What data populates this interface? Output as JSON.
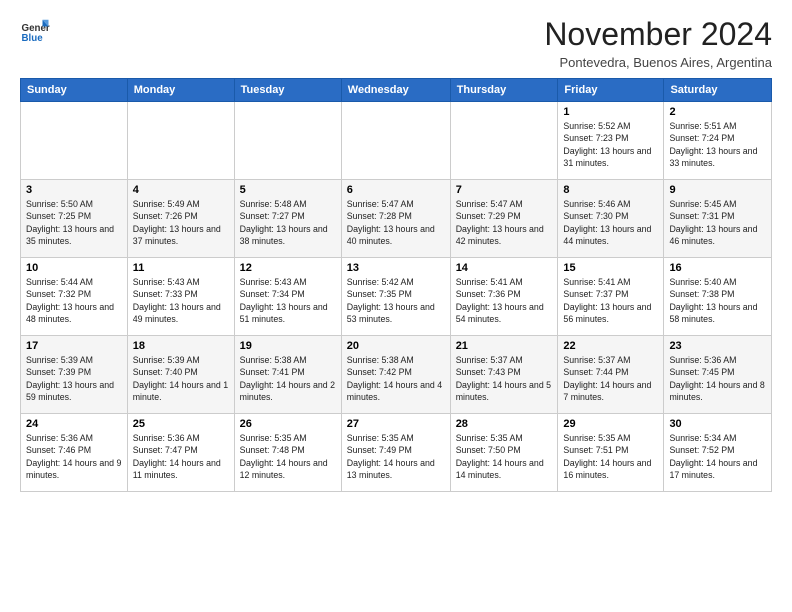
{
  "logo": {
    "general": "General",
    "blue": "Blue"
  },
  "header": {
    "title": "November 2024",
    "subtitle": "Pontevedra, Buenos Aires, Argentina"
  },
  "weekdays": [
    "Sunday",
    "Monday",
    "Tuesday",
    "Wednesday",
    "Thursday",
    "Friday",
    "Saturday"
  ],
  "weeks": [
    [
      {
        "day": "",
        "info": ""
      },
      {
        "day": "",
        "info": ""
      },
      {
        "day": "",
        "info": ""
      },
      {
        "day": "",
        "info": ""
      },
      {
        "day": "",
        "info": ""
      },
      {
        "day": "1",
        "info": "Sunrise: 5:52 AM\nSunset: 7:23 PM\nDaylight: 13 hours and 31 minutes."
      },
      {
        "day": "2",
        "info": "Sunrise: 5:51 AM\nSunset: 7:24 PM\nDaylight: 13 hours and 33 minutes."
      }
    ],
    [
      {
        "day": "3",
        "info": "Sunrise: 5:50 AM\nSunset: 7:25 PM\nDaylight: 13 hours and 35 minutes."
      },
      {
        "day": "4",
        "info": "Sunrise: 5:49 AM\nSunset: 7:26 PM\nDaylight: 13 hours and 37 minutes."
      },
      {
        "day": "5",
        "info": "Sunrise: 5:48 AM\nSunset: 7:27 PM\nDaylight: 13 hours and 38 minutes."
      },
      {
        "day": "6",
        "info": "Sunrise: 5:47 AM\nSunset: 7:28 PM\nDaylight: 13 hours and 40 minutes."
      },
      {
        "day": "7",
        "info": "Sunrise: 5:47 AM\nSunset: 7:29 PM\nDaylight: 13 hours and 42 minutes."
      },
      {
        "day": "8",
        "info": "Sunrise: 5:46 AM\nSunset: 7:30 PM\nDaylight: 13 hours and 44 minutes."
      },
      {
        "day": "9",
        "info": "Sunrise: 5:45 AM\nSunset: 7:31 PM\nDaylight: 13 hours and 46 minutes."
      }
    ],
    [
      {
        "day": "10",
        "info": "Sunrise: 5:44 AM\nSunset: 7:32 PM\nDaylight: 13 hours and 48 minutes."
      },
      {
        "day": "11",
        "info": "Sunrise: 5:43 AM\nSunset: 7:33 PM\nDaylight: 13 hours and 49 minutes."
      },
      {
        "day": "12",
        "info": "Sunrise: 5:43 AM\nSunset: 7:34 PM\nDaylight: 13 hours and 51 minutes."
      },
      {
        "day": "13",
        "info": "Sunrise: 5:42 AM\nSunset: 7:35 PM\nDaylight: 13 hours and 53 minutes."
      },
      {
        "day": "14",
        "info": "Sunrise: 5:41 AM\nSunset: 7:36 PM\nDaylight: 13 hours and 54 minutes."
      },
      {
        "day": "15",
        "info": "Sunrise: 5:41 AM\nSunset: 7:37 PM\nDaylight: 13 hours and 56 minutes."
      },
      {
        "day": "16",
        "info": "Sunrise: 5:40 AM\nSunset: 7:38 PM\nDaylight: 13 hours and 58 minutes."
      }
    ],
    [
      {
        "day": "17",
        "info": "Sunrise: 5:39 AM\nSunset: 7:39 PM\nDaylight: 13 hours and 59 minutes."
      },
      {
        "day": "18",
        "info": "Sunrise: 5:39 AM\nSunset: 7:40 PM\nDaylight: 14 hours and 1 minute."
      },
      {
        "day": "19",
        "info": "Sunrise: 5:38 AM\nSunset: 7:41 PM\nDaylight: 14 hours and 2 minutes."
      },
      {
        "day": "20",
        "info": "Sunrise: 5:38 AM\nSunset: 7:42 PM\nDaylight: 14 hours and 4 minutes."
      },
      {
        "day": "21",
        "info": "Sunrise: 5:37 AM\nSunset: 7:43 PM\nDaylight: 14 hours and 5 minutes."
      },
      {
        "day": "22",
        "info": "Sunrise: 5:37 AM\nSunset: 7:44 PM\nDaylight: 14 hours and 7 minutes."
      },
      {
        "day": "23",
        "info": "Sunrise: 5:36 AM\nSunset: 7:45 PM\nDaylight: 14 hours and 8 minutes."
      }
    ],
    [
      {
        "day": "24",
        "info": "Sunrise: 5:36 AM\nSunset: 7:46 PM\nDaylight: 14 hours and 9 minutes."
      },
      {
        "day": "25",
        "info": "Sunrise: 5:36 AM\nSunset: 7:47 PM\nDaylight: 14 hours and 11 minutes."
      },
      {
        "day": "26",
        "info": "Sunrise: 5:35 AM\nSunset: 7:48 PM\nDaylight: 14 hours and 12 minutes."
      },
      {
        "day": "27",
        "info": "Sunrise: 5:35 AM\nSunset: 7:49 PM\nDaylight: 14 hours and 13 minutes."
      },
      {
        "day": "28",
        "info": "Sunrise: 5:35 AM\nSunset: 7:50 PM\nDaylight: 14 hours and 14 minutes."
      },
      {
        "day": "29",
        "info": "Sunrise: 5:35 AM\nSunset: 7:51 PM\nDaylight: 14 hours and 16 minutes."
      },
      {
        "day": "30",
        "info": "Sunrise: 5:34 AM\nSunset: 7:52 PM\nDaylight: 14 hours and 17 minutes."
      }
    ]
  ]
}
